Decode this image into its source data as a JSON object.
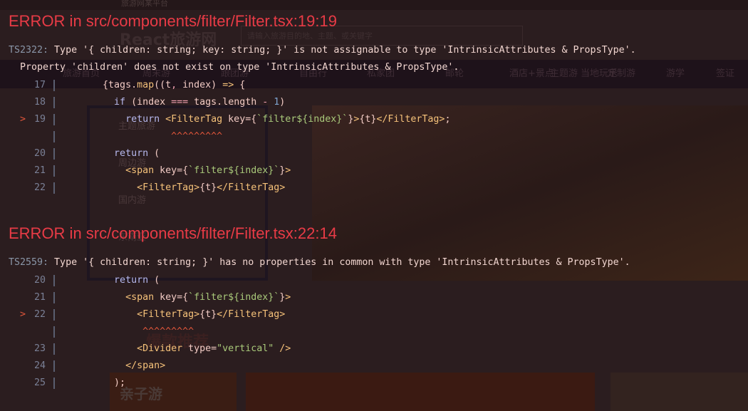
{
  "background_page": {
    "browser_tab": "旅游网某平台",
    "logo": "React旅游网",
    "search_placeholder": "请输入旅游目的地、主题、或关键字",
    "nav": [
      "旅游首页",
      "周末游",
      "跟团游",
      "自由行",
      "私家团",
      "邮轮",
      "酒店+景点",
      "当地玩乐",
      "主题游",
      "定制游",
      "游学",
      "签证"
    ],
    "side_menu": [
      "主题旅游",
      "周边游",
      "国内游",
      "东南亚"
    ],
    "section_title": "爆款推荐",
    "card_title": "亲子游"
  },
  "errors": [
    {
      "title": "ERROR in src/components/filter/Filter.tsx:19:19",
      "code": "TS2322:",
      "message": " Type '{ children: string; key: string; }' is not assignable to type 'IntrinsicAttributes & PropsType'.",
      "detail": "Property 'children' does not exist on type 'IntrinsicAttributes & PropsType'.",
      "lines": [
        {
          "num": "17",
          "mark": "",
          "tokens": [
            [
              "p",
              "        {tags."
            ],
            [
              "g",
              "map"
            ],
            [
              "p",
              "(("
            ],
            [
              "p",
              "t"
            ],
            [
              "o",
              ", "
            ],
            [
              "p",
              "index) "
            ],
            [
              "g",
              "=>"
            ],
            [
              "p",
              " {"
            ]
          ]
        },
        {
          "num": "18",
          "mark": "",
          "tokens": [
            [
              "k",
              "          if"
            ],
            [
              "p",
              " (index "
            ],
            [
              "o",
              "==="
            ],
            [
              "p",
              " tags.length "
            ],
            [
              "o",
              "-"
            ],
            [
              "n",
              " 1"
            ],
            [
              "p",
              ")"
            ]
          ]
        },
        {
          "num": "19",
          "mark": ">",
          "tokens": [
            [
              "k",
              "            return"
            ],
            [
              "g",
              " <FilterTag"
            ],
            [
              "p",
              " key={"
            ],
            [
              "s",
              "`filter${index}`"
            ],
            [
              "p",
              "}"
            ],
            [
              "g",
              ">"
            ],
            [
              "p",
              "{t}"
            ],
            [
              "g",
              "</FilterTag>"
            ],
            [
              "p",
              ";"
            ]
          ]
        },
        {
          "num": "",
          "mark": "",
          "tokens": [
            [
              "c",
              "                    ^^^^^^^^^"
            ]
          ]
        },
        {
          "num": "20",
          "mark": "",
          "tokens": [
            [
              "k",
              "          return"
            ],
            [
              "p",
              " ("
            ]
          ]
        },
        {
          "num": "21",
          "mark": "",
          "tokens": [
            [
              "g",
              "            <span"
            ],
            [
              "p",
              " key={"
            ],
            [
              "s",
              "`filter${index}`"
            ],
            [
              "p",
              "}"
            ],
            [
              "g",
              ">"
            ]
          ]
        },
        {
          "num": "22",
          "mark": "",
          "tokens": [
            [
              "g",
              "              <FilterTag>"
            ],
            [
              "p",
              "{t}"
            ],
            [
              "g",
              "</FilterTag>"
            ]
          ]
        }
      ]
    },
    {
      "title": "ERROR in src/components/filter/Filter.tsx:22:14",
      "code": "TS2559:",
      "message": " Type '{ children: string; }' has no properties in common with type 'IntrinsicAttributes & PropsType'.",
      "detail": "",
      "lines": [
        {
          "num": "20",
          "mark": "",
          "tokens": [
            [
              "k",
              "          return"
            ],
            [
              "p",
              " ("
            ]
          ]
        },
        {
          "num": "21",
          "mark": "",
          "tokens": [
            [
              "g",
              "            <span"
            ],
            [
              "p",
              " key={"
            ],
            [
              "s",
              "`filter${index}`"
            ],
            [
              "p",
              "}"
            ],
            [
              "g",
              ">"
            ]
          ]
        },
        {
          "num": "22",
          "mark": ">",
          "tokens": [
            [
              "g",
              "              <FilterTag>"
            ],
            [
              "p",
              "{t}"
            ],
            [
              "g",
              "</FilterTag>"
            ]
          ]
        },
        {
          "num": "",
          "mark": "",
          "tokens": [
            [
              "c",
              "               ^^^^^^^^^"
            ]
          ]
        },
        {
          "num": "23",
          "mark": "",
          "tokens": [
            [
              "g",
              "              <Divider"
            ],
            [
              "p",
              " type="
            ],
            [
              "s",
              "\"vertical\""
            ],
            [
              "g",
              " />"
            ]
          ]
        },
        {
          "num": "24",
          "mark": "",
          "tokens": [
            [
              "g",
              "            </span>"
            ]
          ]
        },
        {
          "num": "25",
          "mark": "",
          "tokens": [
            [
              "p",
              "          );"
            ]
          ]
        }
      ]
    }
  ]
}
